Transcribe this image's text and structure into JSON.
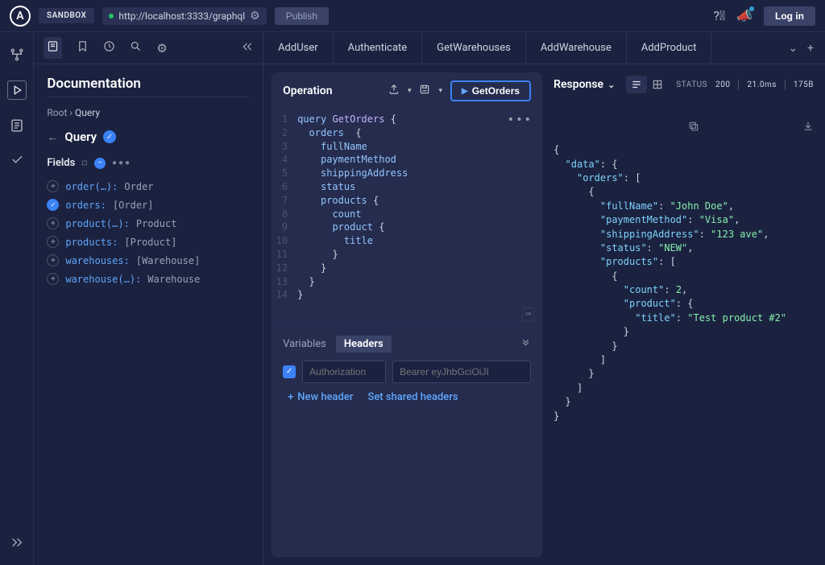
{
  "topbar": {
    "logo_letter": "A",
    "sandbox_label": "SANDBOX",
    "url": "http://localhost:3333/graphql",
    "publish_label": "Publish",
    "login_label": "Log in"
  },
  "tabs": [
    {
      "label": "AddUser"
    },
    {
      "label": "Authenticate"
    },
    {
      "label": "GetWarehouses"
    },
    {
      "label": "AddWarehouse"
    },
    {
      "label": "AddProduct"
    }
  ],
  "doc": {
    "title": "Documentation",
    "breadcrumb_root": "Root",
    "breadcrumb_sep": "›",
    "breadcrumb_current": "Query",
    "query_title": "Query",
    "fields_label": "Fields",
    "fields": [
      {
        "name": "order(…):",
        "type": "Order",
        "added": false
      },
      {
        "name": "orders:",
        "type": "[Order]",
        "added": true
      },
      {
        "name": "product(…):",
        "type": "Product",
        "added": false
      },
      {
        "name": "products:",
        "type": "[Product]",
        "added": false
      },
      {
        "name": "warehouses:",
        "type": "[Warehouse]",
        "added": false
      },
      {
        "name": "warehouse(…):",
        "type": "Warehouse",
        "added": false
      }
    ]
  },
  "operation": {
    "title": "Operation",
    "run_label": "GetOrders",
    "code": [
      {
        "num": "1",
        "q": "query ",
        "op": "GetOrders",
        "tail": " {"
      },
      {
        "num": "2",
        "indent": "  ",
        "f": "orders",
        "tail": "  {"
      },
      {
        "num": "3",
        "indent": "    ",
        "f": "fullName"
      },
      {
        "num": "4",
        "indent": "    ",
        "f": "paymentMethod"
      },
      {
        "num": "5",
        "indent": "    ",
        "f": "shippingAddress"
      },
      {
        "num": "6",
        "indent": "    ",
        "f": "status"
      },
      {
        "num": "7",
        "indent": "    ",
        "f": "products",
        "tail": " {"
      },
      {
        "num": "8",
        "indent": "      ",
        "f": "count"
      },
      {
        "num": "9",
        "indent": "      ",
        "f": "product",
        "tail": " {"
      },
      {
        "num": "10",
        "indent": "        ",
        "f": "title"
      },
      {
        "num": "11",
        "indent": "      ",
        "close": "}"
      },
      {
        "num": "12",
        "indent": "    ",
        "close": "}"
      },
      {
        "num": "13",
        "indent": "  ",
        "close": "}"
      },
      {
        "num": "14",
        "indent": "",
        "close": "}"
      }
    ]
  },
  "vars": {
    "variables_tab": "Variables",
    "headers_tab": "Headers",
    "header_key_placeholder": "Authorization",
    "header_val_placeholder": "Bearer eyJhbGciOiJI",
    "new_header": "New header",
    "set_shared": "Set shared headers"
  },
  "response": {
    "title": "Response",
    "status_label": "STATUS",
    "status_code": "200",
    "time": "21.0ms",
    "size": "175B",
    "json": {
      "data": {
        "orders": [
          {
            "fullName": "John Doe",
            "paymentMethod": "Visa",
            "shippingAddress": "123 ave",
            "status": "NEW",
            "products": [
              {
                "count": 2,
                "product": {
                  "title": "Test product #2"
                }
              }
            ]
          }
        ]
      }
    }
  }
}
